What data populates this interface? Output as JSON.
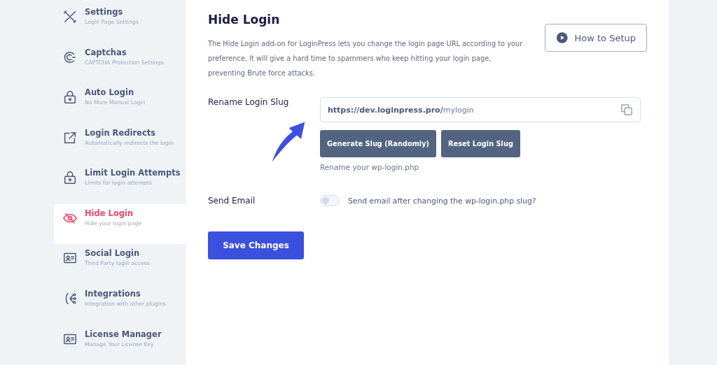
{
  "sidebar": {
    "items": [
      {
        "title": "Settings",
        "subtitle": "Login Page Settings",
        "selected": false
      },
      {
        "title": "Captchas",
        "subtitle": "CAPTCHA Protection Settings",
        "selected": false
      },
      {
        "title": "Auto Login",
        "subtitle": "No More Manual Login",
        "selected": false
      },
      {
        "title": "Login Redirects",
        "subtitle": "Automatically redirects the login",
        "selected": false
      },
      {
        "title": "Limit Login Attempts",
        "subtitle": "Limits for login attempts",
        "selected": false
      },
      {
        "title": "Hide Login",
        "subtitle": "Hide your login page",
        "selected": true
      },
      {
        "title": "Social Login",
        "subtitle": "Third Party login access",
        "selected": false
      },
      {
        "title": "Integrations",
        "subtitle": "Integration with other plugins",
        "selected": false
      },
      {
        "title": "License Manager",
        "subtitle": "Manage Your License Key",
        "selected": false
      }
    ]
  },
  "main": {
    "title": "Hide Login",
    "description": "The Hide Login add-on for LoginPress lets you change the login page URL according to your preference. It will give a hard time to spammers who keep hitting your login page, preventing Brute force attacks.",
    "setup_button": "How to Setup",
    "slug": {
      "label": "Rename Login Slug",
      "value": "**https://dev.loginpress.pro/**mylogin",
      "buttons": [
        "Generate Slug (Randomly)",
        "Reset Login Slug"
      ],
      "help": "Rename your wp-login.php"
    },
    "email": {
      "label": "Send Email",
      "on": false,
      "text": "Send email after changing the wp-login.php slug?"
    },
    "save_button": "Save Changes"
  }
}
